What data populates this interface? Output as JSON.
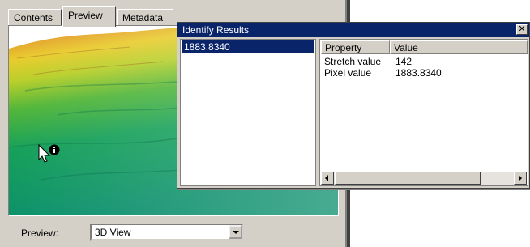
{
  "tabs": [
    {
      "label": "Contents",
      "active": false
    },
    {
      "label": "Preview",
      "active": true
    },
    {
      "label": "Metadata",
      "active": false
    }
  ],
  "preview": {
    "label": "Preview:",
    "selected_option": "3D View"
  },
  "identify_window": {
    "title": "Identify Results",
    "close_label": "✕",
    "results": [
      "1883.8340"
    ],
    "columns": [
      "Property",
      "Value"
    ],
    "rows": [
      {
        "property": "Stretch value",
        "value": "142"
      },
      {
        "property": "Pixel value",
        "value": "1883.8340"
      }
    ]
  },
  "icons": {
    "cursor": "identify-cursor-icon",
    "close": "close-icon",
    "dropdown": "chevron-down-icon"
  },
  "colors": {
    "titlebar": "#0a246a",
    "selection": "#0a246a",
    "window_face": "#d4d0c8"
  }
}
